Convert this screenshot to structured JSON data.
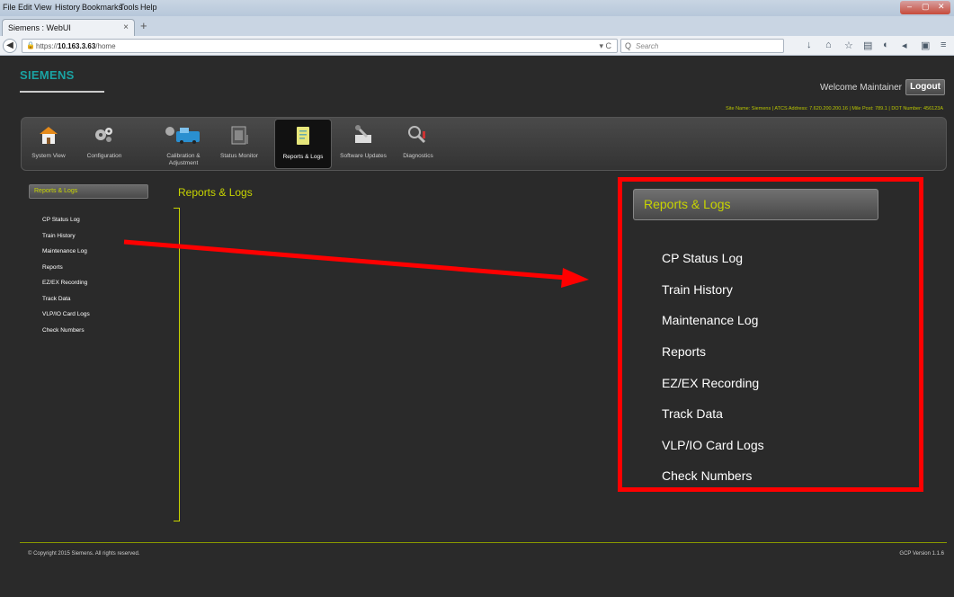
{
  "browser": {
    "menu": [
      "File",
      "Edit",
      "View",
      "History",
      "Bookmarks",
      "Tools",
      "Help"
    ],
    "tab_title": "Siemens : WebUI",
    "tab_close": "×",
    "new_tab": "+",
    "back": "◀",
    "lock": "🔒",
    "url_prefix": "https://",
    "url_host": "10.163.3.63",
    "url_path": "/home",
    "url_reload": "▾ C",
    "search_icon": "Q",
    "search_placeholder": "Search",
    "window_controls": [
      "–",
      "▢",
      "✕"
    ],
    "toolbar_icons": [
      "↓",
      "⌂",
      "☆",
      "▤",
      "◐",
      "◂",
      "▣",
      "≡"
    ]
  },
  "header": {
    "logo": "SIEMENS",
    "welcome": "Welcome Maintainer",
    "logout": "Logout",
    "site_info": "Site Name: Siemens | ATCS Address: 7.620.200.200.16 | Mile Post: 789.1 | DOT Number: 456123A"
  },
  "toolbar": {
    "items": [
      {
        "label": "System View",
        "icon": "house-icon"
      },
      {
        "label": "Configuration",
        "icon": "gears-icon"
      },
      {
        "label": "Calibration & Adjustment",
        "icon": "calibration-icon"
      },
      {
        "label": "Status Monitor",
        "icon": "monitor-icon"
      },
      {
        "label": "Reports & Logs",
        "icon": "report-icon"
      },
      {
        "label": "Software Updates",
        "icon": "tools-icon"
      },
      {
        "label": "Diagnostics",
        "icon": "diagnostics-icon"
      }
    ],
    "active": "Reports & Logs"
  },
  "sidebar": {
    "header": "Reports & Logs",
    "items": [
      "CP Status Log",
      "Train History",
      "Maintenance Log",
      "Reports",
      "EZ/EX Recording",
      "Track Data",
      "VLP/IO Card Logs",
      "Check Numbers"
    ]
  },
  "main": {
    "title": "Reports & Logs"
  },
  "callout": {
    "header": "Reports & Logs",
    "items": [
      "CP Status Log",
      "Train History",
      "Maintenance Log",
      "Reports",
      "EZ/EX Recording",
      "Track Data",
      "VLP/IO Card Logs",
      "Check Numbers"
    ],
    "annotation_color": "#ff0000"
  },
  "footer": {
    "copyright": "© Copyright 2015 Siemens. All rights reserved.",
    "version": "GCP Version 1.1.6"
  },
  "colors": {
    "accent": "#c8d400",
    "background": "#2a2a2a",
    "brand": "#1aa3a3"
  }
}
